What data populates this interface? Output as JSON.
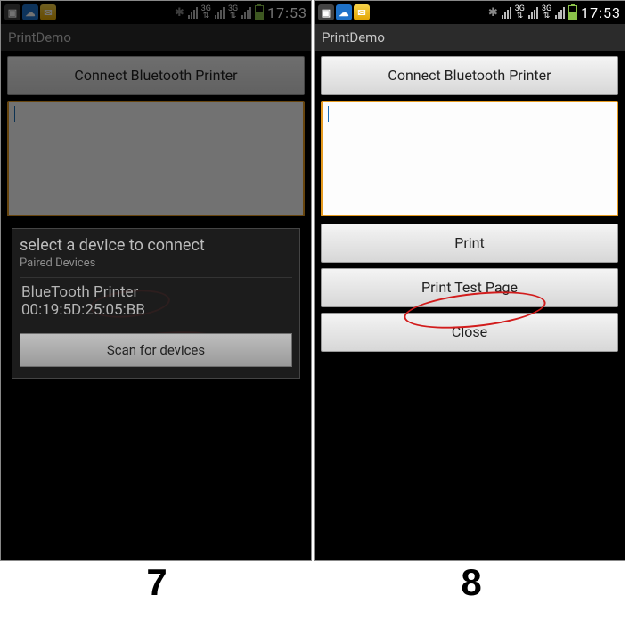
{
  "status": {
    "clock": "17:53"
  },
  "app": {
    "title": "PrintDemo"
  },
  "left": {
    "connect_label": "Connect Bluetooth Printer",
    "dialog": {
      "title": "select a device to connect",
      "subtitle": "Paired Devices",
      "device_name": "BlueTooth Printer",
      "device_mac": "00:19:5D:25:05:BB",
      "scan_label": "Scan for devices"
    }
  },
  "right": {
    "connect_label": "Connect Bluetooth Printer",
    "buttons": {
      "print": "Print",
      "print_test": "Print Test Page",
      "close": "Close"
    }
  },
  "figure_labels": {
    "left": "7",
    "right": "8"
  }
}
